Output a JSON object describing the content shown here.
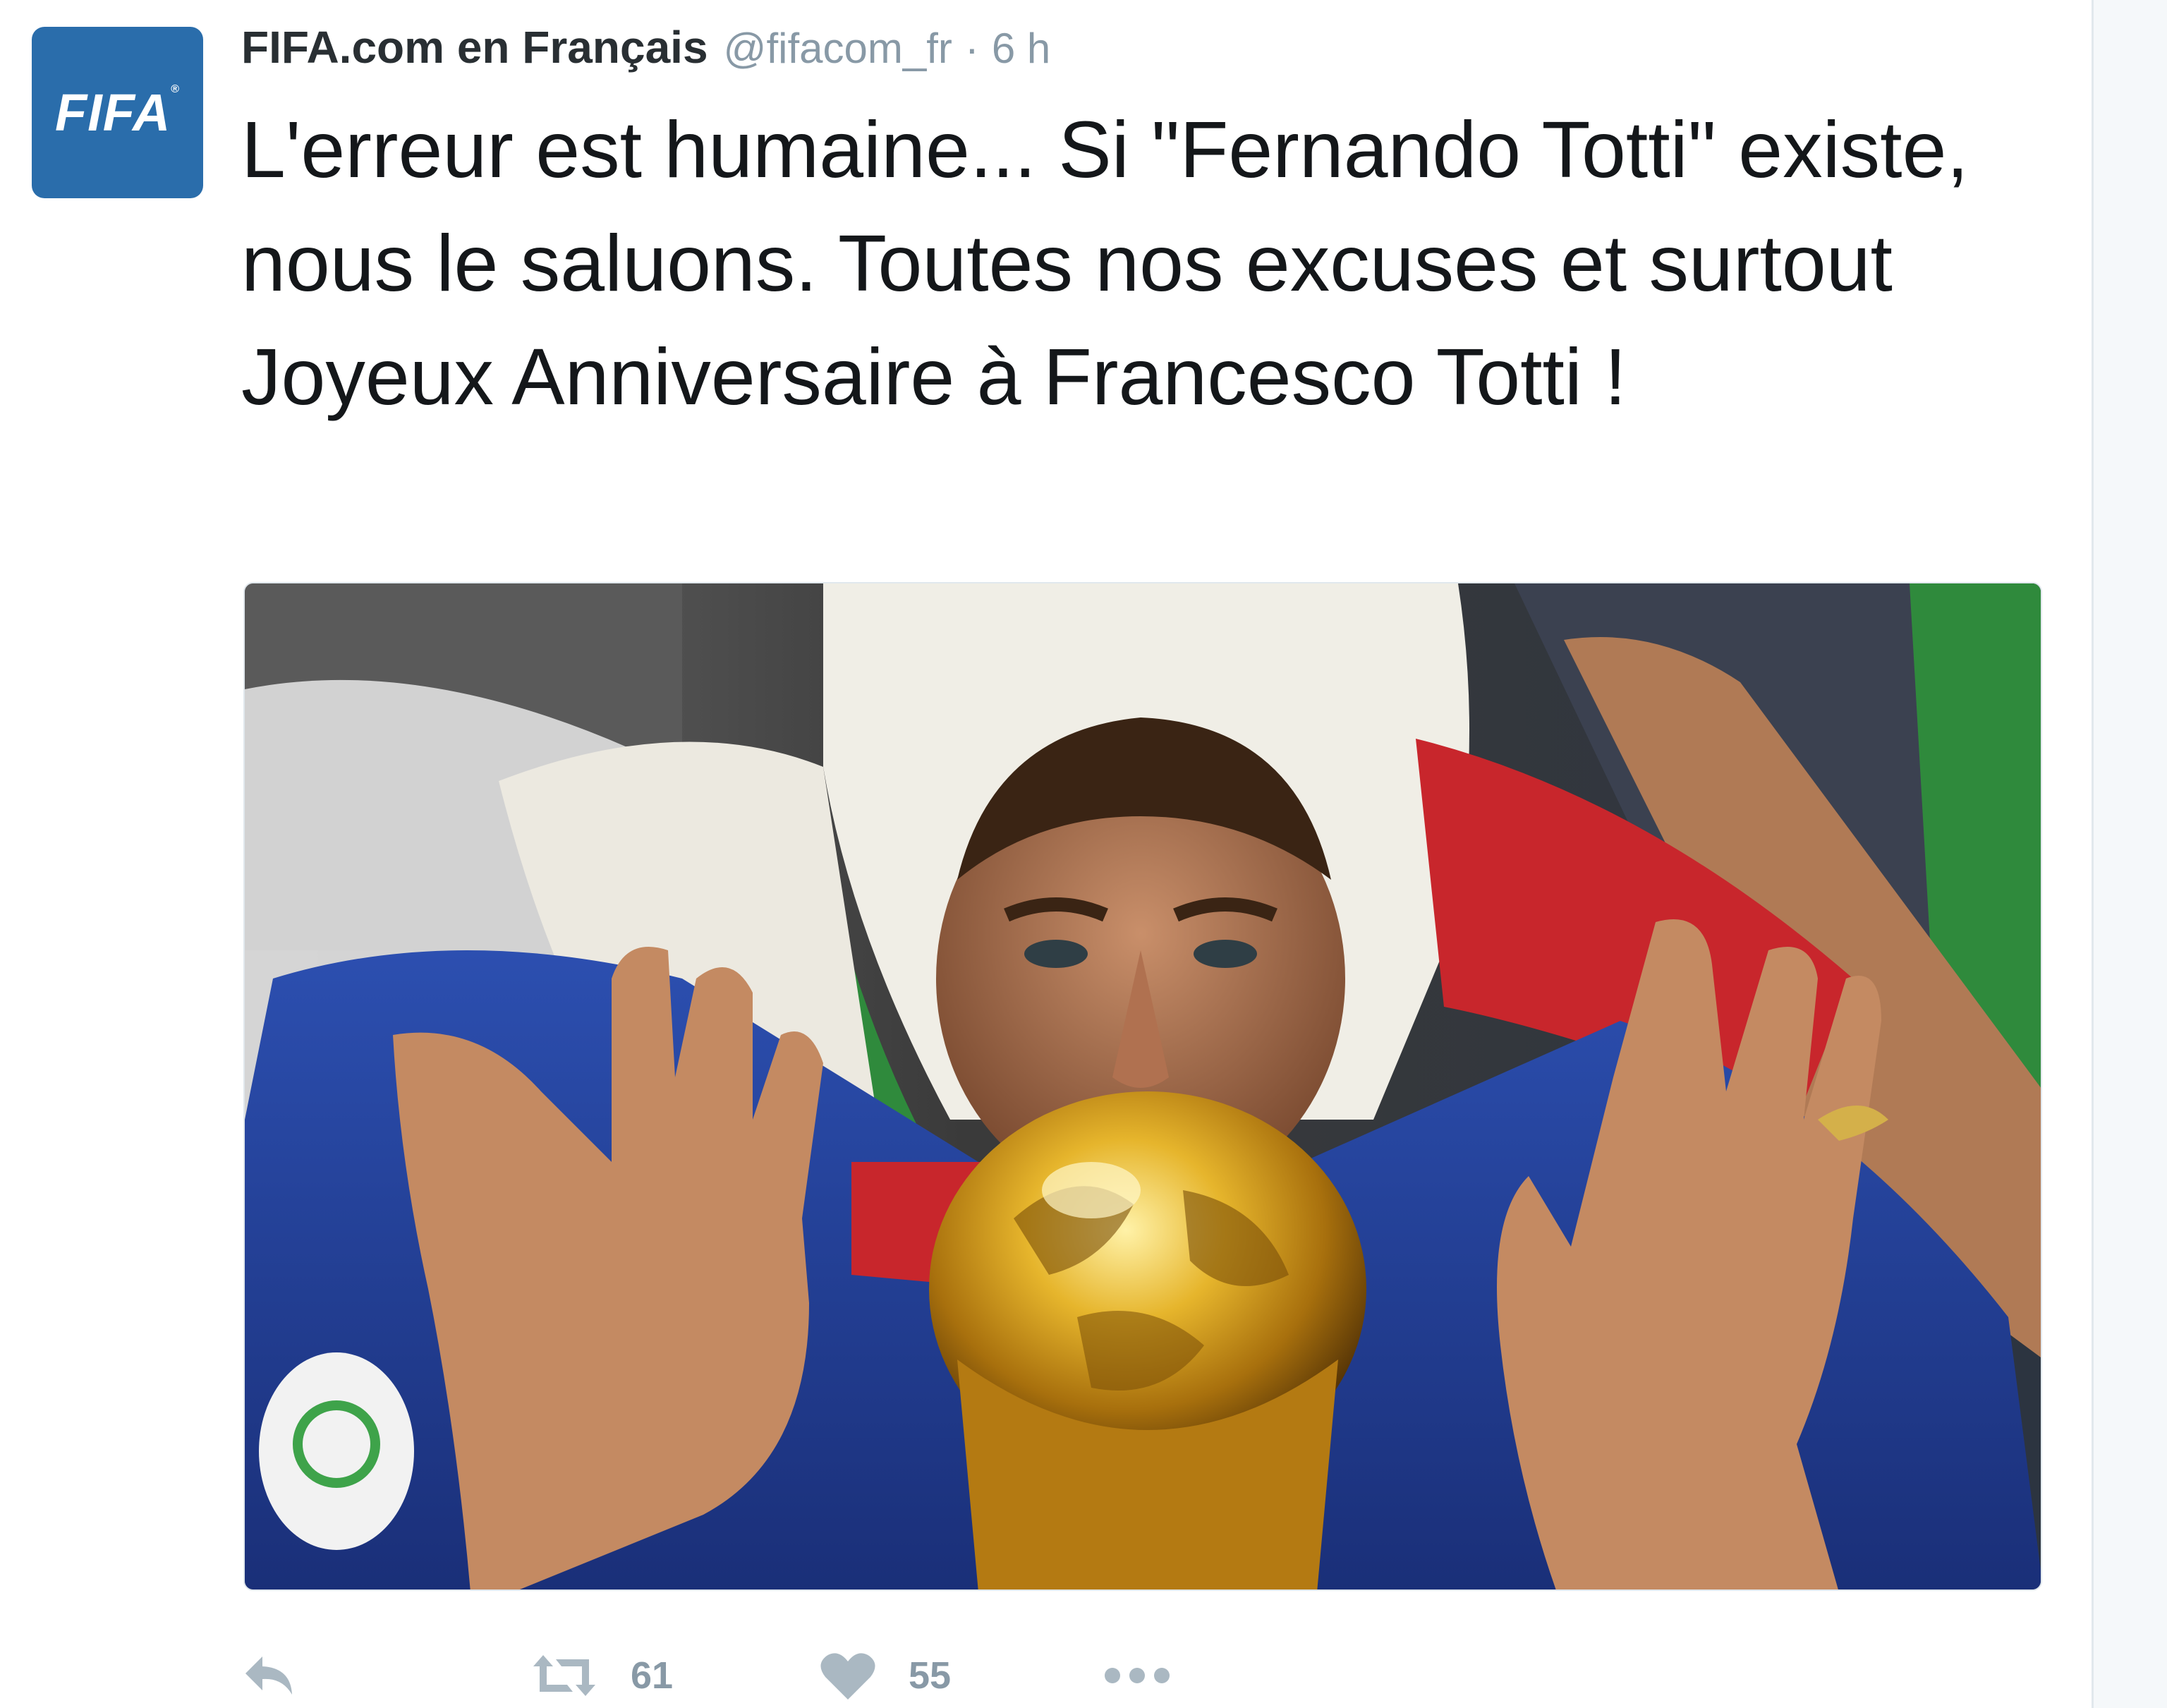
{
  "account": {
    "display_name": "FIFA.com en Français",
    "handle": "@fifacom_fr",
    "separator": "·",
    "time": "6 h",
    "avatar_label": "FIFA",
    "avatar_mark": "®",
    "avatar_color": "#2a6dab"
  },
  "tweet": {
    "text": "L'erreur est humaine... Si \"Fernando Totti\" existe, nous le saluons. Toutes nos excuses et surtout Joyeux Anniversaire à Francesco Totti !"
  },
  "media": {
    "type": "photo"
  },
  "actions": {
    "reply": {
      "icon": "reply-icon"
    },
    "retweet": {
      "icon": "retweet-icon",
      "count": "61"
    },
    "like": {
      "icon": "heart-icon",
      "count": "55"
    },
    "more": {
      "icon": "more-dots-icon"
    }
  },
  "colors": {
    "secondary_text": "#8899a6",
    "action_icon": "#aab8c2"
  }
}
